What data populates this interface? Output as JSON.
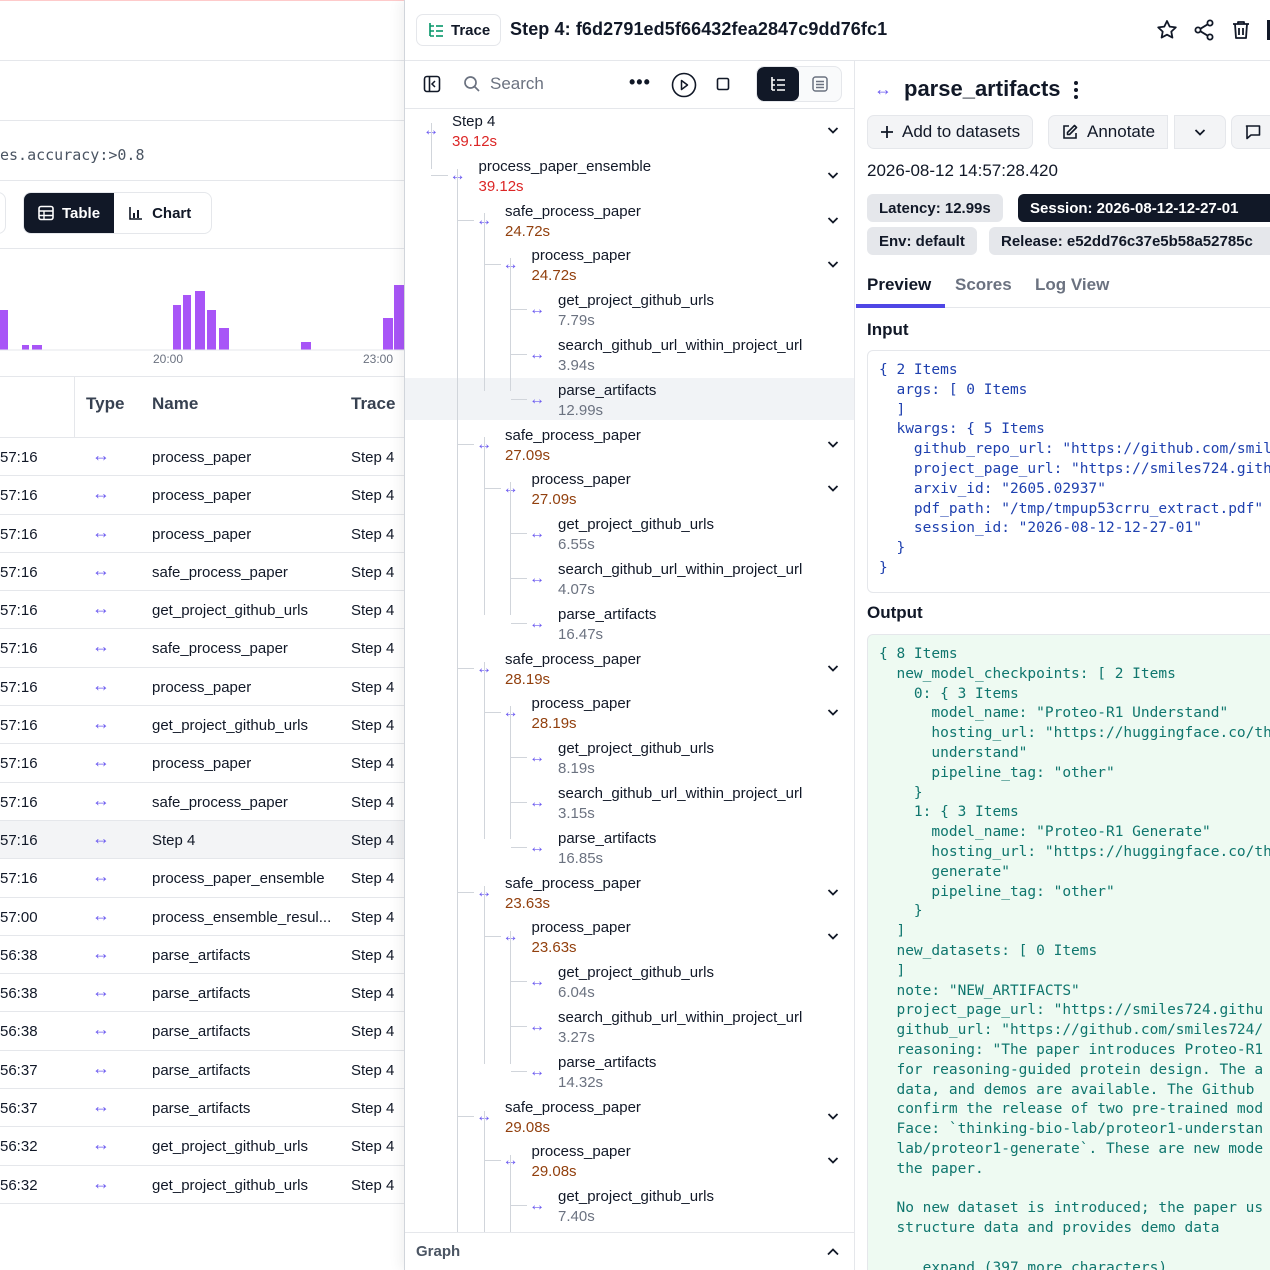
{
  "background": {
    "filter_text": "es.accuracy:>0.8",
    "view_toggle": {
      "table_label": "Table",
      "chart_label": "Chart"
    },
    "histogram": {
      "tick_labels": [
        "20:00",
        "23:00"
      ]
    },
    "columns": [
      "Type",
      "Name",
      "Trace"
    ],
    "rows": [
      {
        "time": "57:16",
        "name": "process_paper",
        "trace": "Step 4"
      },
      {
        "time": "57:16",
        "name": "process_paper",
        "trace": "Step 4"
      },
      {
        "time": "57:16",
        "name": "process_paper",
        "trace": "Step 4"
      },
      {
        "time": "57:16",
        "name": "safe_process_paper",
        "trace": "Step 4"
      },
      {
        "time": "57:16",
        "name": "get_project_github_urls",
        "trace": "Step 4"
      },
      {
        "time": "57:16",
        "name": "safe_process_paper",
        "trace": "Step 4"
      },
      {
        "time": "57:16",
        "name": "process_paper",
        "trace": "Step 4"
      },
      {
        "time": "57:16",
        "name": "get_project_github_urls",
        "trace": "Step 4"
      },
      {
        "time": "57:16",
        "name": "process_paper",
        "trace": "Step 4"
      },
      {
        "time": "57:16",
        "name": "safe_process_paper",
        "trace": "Step 4"
      },
      {
        "time": "57:16",
        "name": "Step 4",
        "trace": "Step 4"
      },
      {
        "time": "57:16",
        "name": "process_paper_ensemble",
        "trace": "Step 4"
      },
      {
        "time": "57:00",
        "name": "process_ensemble_resul...",
        "trace": "Step 4"
      },
      {
        "time": "56:38",
        "name": "parse_artifacts",
        "trace": "Step 4"
      },
      {
        "time": "56:38",
        "name": "parse_artifacts",
        "trace": "Step 4"
      },
      {
        "time": "56:38",
        "name": "parse_artifacts",
        "trace": "Step 4"
      },
      {
        "time": "56:37",
        "name": "parse_artifacts",
        "trace": "Step 4"
      },
      {
        "time": "56:37",
        "name": "parse_artifacts",
        "trace": "Step 4"
      },
      {
        "time": "56:32",
        "name": "get_project_github_urls",
        "trace": "Step 4"
      },
      {
        "time": "56:32",
        "name": "get_project_github_urls",
        "trace": "Step 4"
      }
    ]
  },
  "header": {
    "chip_label": "Trace",
    "title": "Step 4: f6d2791ed5f66432fea2847c9dd76fc1"
  },
  "tree": {
    "search_placeholder": "Search",
    "nodes": [
      {
        "label": "Step 4",
        "duration": "39.12s"
      },
      {
        "label": "process_paper_ensemble",
        "duration": "39.12s"
      },
      {
        "label": "safe_process_paper",
        "duration": "24.72s"
      },
      {
        "label": "process_paper",
        "duration": "24.72s"
      },
      {
        "label": "get_project_github_urls",
        "duration": "7.79s"
      },
      {
        "label": "search_github_url_within_project_url",
        "duration": "3.94s"
      },
      {
        "label": "parse_artifacts",
        "duration": "12.99s"
      },
      {
        "label": "safe_process_paper",
        "duration": "27.09s"
      },
      {
        "label": "process_paper",
        "duration": "27.09s"
      },
      {
        "label": "get_project_github_urls",
        "duration": "6.55s"
      },
      {
        "label": "search_github_url_within_project_url",
        "duration": "4.07s"
      },
      {
        "label": "parse_artifacts",
        "duration": "16.47s"
      },
      {
        "label": "safe_process_paper",
        "duration": "28.19s"
      },
      {
        "label": "process_paper",
        "duration": "28.19s"
      },
      {
        "label": "get_project_github_urls",
        "duration": "8.19s"
      },
      {
        "label": "search_github_url_within_project_url",
        "duration": "3.15s"
      },
      {
        "label": "parse_artifacts",
        "duration": "16.85s"
      },
      {
        "label": "safe_process_paper",
        "duration": "23.63s"
      },
      {
        "label": "process_paper",
        "duration": "23.63s"
      },
      {
        "label": "get_project_github_urls",
        "duration": "6.04s"
      },
      {
        "label": "search_github_url_within_project_url",
        "duration": "3.27s"
      },
      {
        "label": "parse_artifacts",
        "duration": "14.32s"
      },
      {
        "label": "safe_process_paper",
        "duration": "29.08s"
      },
      {
        "label": "process_paper",
        "duration": "29.08s"
      },
      {
        "label": "get_project_github_urls",
        "duration": "7.40s"
      }
    ],
    "graph_label": "Graph"
  },
  "detail": {
    "title": "parse_artifacts",
    "add_to_datasets": "Add to datasets",
    "annotate": "Annotate",
    "timestamp": "2026-08-12 14:57:28.420",
    "tags": {
      "latency": "Latency: 12.99s",
      "session": "Session: 2026-08-12-12-27-01",
      "env": "Env: default",
      "release": "Release: e52dd76c37e5b58a52785c"
    },
    "tabs": [
      "Preview",
      "Scores",
      "Log View"
    ],
    "input_heading": "Input",
    "output_heading": "Output",
    "input_lines": [
      "{ 2 Items",
      "  args: [ 0 Items",
      "  ]",
      "  kwargs: { 5 Items",
      "    github_repo_url: \"https://github.com/smil",
      "    project_page_url: \"https://smiles724.gith",
      "    arxiv_id: \"2605.02937\"",
      "    pdf_path: \"/tmp/tmpup53crru_extract.pdf\"",
      "    session_id: \"2026-08-12-12-27-01\"",
      "  }",
      "}"
    ],
    "output_lines": [
      "{ 8 Items",
      "  new_model_checkpoints: [ 2 Items",
      "    0: { 3 Items",
      "      model_name: \"Proteo-R1 Understand\"",
      "      hosting_url: \"https://huggingface.co/th",
      "      understand\"",
      "      pipeline_tag: \"other\"",
      "    }",
      "    1: { 3 Items",
      "      model_name: \"Proteo-R1 Generate\"",
      "      hosting_url: \"https://huggingface.co/th",
      "      generate\"",
      "      pipeline_tag: \"other\"",
      "    }",
      "  ]",
      "  new_datasets: [ 0 Items",
      "  ]",
      "  note: \"NEW_ARTIFACTS\"",
      "  project_page_url: \"https://smiles724.githu",
      "  github_url: \"https://github.com/smiles724/",
      "  reasoning: \"The paper introduces Proteo-R1",
      "  for reasoning-guided protein design. The a",
      "  data, and demos are available. The Github ",
      "  confirm the release of two pre-trained mod",
      "  Face: `thinking-bio-lab/proteor1-understan",
      "  lab/proteor1-generate`. These are new mode",
      "  the paper.",
      "",
      "  No new dataset is introduced; the paper us",
      "  structure data and provides demo data",
      "",
      "     expand (397 more characters)"
    ]
  }
}
